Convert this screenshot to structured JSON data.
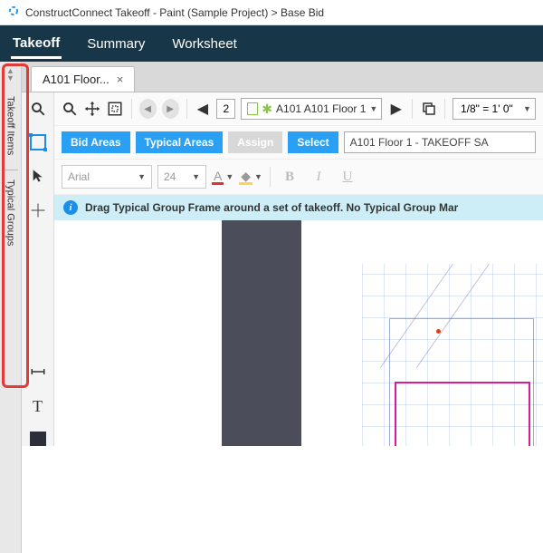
{
  "window": {
    "title": "ConstructConnect Takeoff - Paint (Sample Project) > Base Bid"
  },
  "nav": {
    "takeoff": "Takeoff",
    "summary": "Summary",
    "worksheet": "Worksheet"
  },
  "sidebar": {
    "tab_items": "Takeoff Items",
    "tab_groups": "Typical Groups"
  },
  "doc_tab": {
    "label": "A101 Floor...",
    "close": "×"
  },
  "toolbar": {
    "page_num": "2",
    "page_label": "A101 A101 Floor 1",
    "scale": "1/8\" = 1' 0\""
  },
  "actions": {
    "bid_areas": "Bid Areas",
    "typical_areas": "Typical Areas",
    "assign": "Assign",
    "select": "Select",
    "description": "A101 Floor 1 - TAKEOFF SA"
  },
  "format": {
    "font": "Arial",
    "size": "24",
    "bold": "B",
    "italic": "I",
    "underline": "U"
  },
  "info": {
    "message": "Drag Typical Group Frame around a set of takeoff. No Typical Group Mar"
  }
}
